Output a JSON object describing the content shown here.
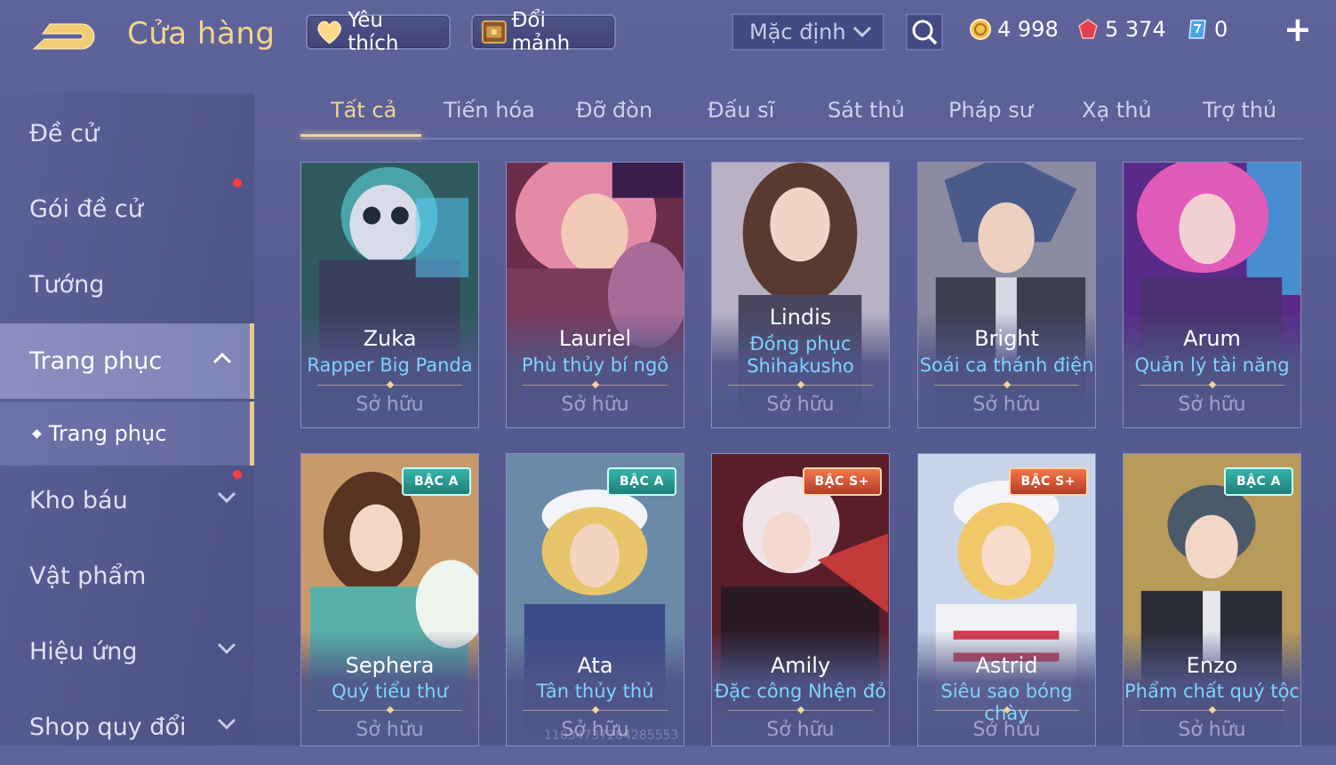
{
  "header": {
    "title": "Cửa hàng",
    "favorites_label": "Yêu thích",
    "exchange_label": "Đổi mảnh",
    "sort_label": "Mặc định",
    "currencies": [
      {
        "name": "gold-coin",
        "value": "4 998"
      },
      {
        "name": "ruby",
        "value": "5 374"
      },
      {
        "name": "voucher",
        "value": "0"
      }
    ],
    "plus": "+"
  },
  "sidebar": {
    "items": [
      {
        "label": "Đề cử"
      },
      {
        "label": "Gói đề cử"
      },
      {
        "label": "Tướng"
      },
      {
        "label": "Trang phục"
      },
      {
        "label": "Kho báu"
      },
      {
        "label": "Vật phẩm"
      },
      {
        "label": "Hiệu ứng"
      },
      {
        "label": "Shop quy đổi"
      }
    ],
    "sub_item": "Trang phục"
  },
  "tabs": [
    "Tất cả",
    "Tiến hóa",
    "Đỡ đòn",
    "Đấu sĩ",
    "Sát thủ",
    "Pháp sư",
    "Xạ thủ",
    "Trợ thủ"
  ],
  "cards": [
    {
      "hero": "Zuka",
      "skin": "Rapper Big Panda",
      "status": "Sở hữu",
      "badge": ""
    },
    {
      "hero": "Lauriel",
      "skin": "Phù thủy bí ngô",
      "status": "Sở hữu",
      "badge": ""
    },
    {
      "hero": "Lindis",
      "skin": "Đồng phục Shihakusho",
      "status": "Sở hữu",
      "badge": ""
    },
    {
      "hero": "Bright",
      "skin": "Soái ca thánh điện",
      "status": "Sở hữu",
      "badge": ""
    },
    {
      "hero": "Arum",
      "skin": "Quản lý tài năng",
      "status": "Sở hữu",
      "badge": ""
    },
    {
      "hero": "Sephera",
      "skin": "Quý tiểu thư",
      "status": "Sở hữu",
      "badge": "BẬC A"
    },
    {
      "hero": "Ata",
      "skin": "Tân thủy thủ",
      "status": "Sở hữu",
      "badge": "BẬC A"
    },
    {
      "hero": "Amily",
      "skin": "Đặc công Nhện đỏ",
      "status": "Sở hữu",
      "badge": "BẬC S+"
    },
    {
      "hero": "Astrid",
      "skin": "Siêu sao bóng chày",
      "status": "Sở hữu",
      "badge": "BẬC S+"
    },
    {
      "hero": "Enzo",
      "skin": "Phẩm chất quý tộc",
      "status": "Sở hữu",
      "badge": "BẬC A"
    }
  ],
  "watermark": "11034737284285553",
  "colors": {
    "accent_gold": "#f2d48f",
    "skin_text": "#7fd2ff",
    "badge_a": "#1e7f7a",
    "badge_s": "#b23c26",
    "notify_dot": "#ff3b3b"
  }
}
